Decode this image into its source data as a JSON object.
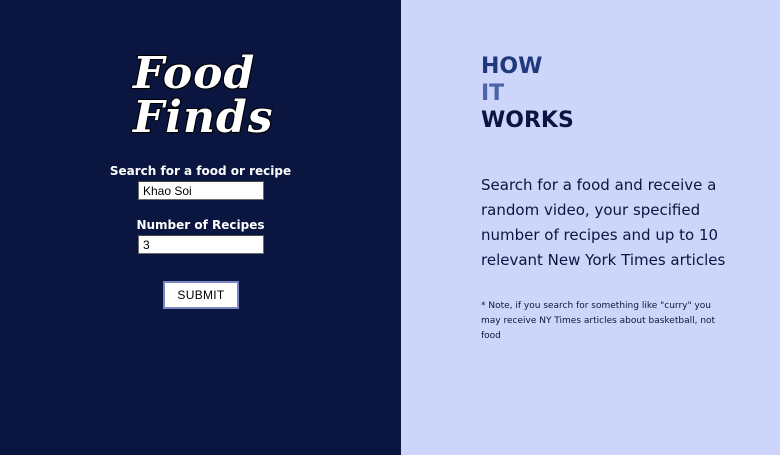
{
  "brand": {
    "line1": "Food",
    "line2": "Finds"
  },
  "form": {
    "search_label": "Search for a food or recipe",
    "search_value": "Khao Soi",
    "num_label": "Number of Recipes",
    "num_value": "3",
    "submit_label": "SUBMIT"
  },
  "how": {
    "word1": "HOW",
    "word2": "IT",
    "word3": "WORKS",
    "description": "Search for a food and receive a random video, your specified number of recipes and up to 10 relevant New York Times articles",
    "note": "* Note, if you search for something like \"curry\" you may receive NY Times articles about basketball, not food"
  },
  "colors": {
    "left_background": "#0a1640",
    "right_background": "#cdd6fa",
    "how_color": "#1f3a7c",
    "it_color": "#4b63a8",
    "works_color": "#0a1640"
  }
}
